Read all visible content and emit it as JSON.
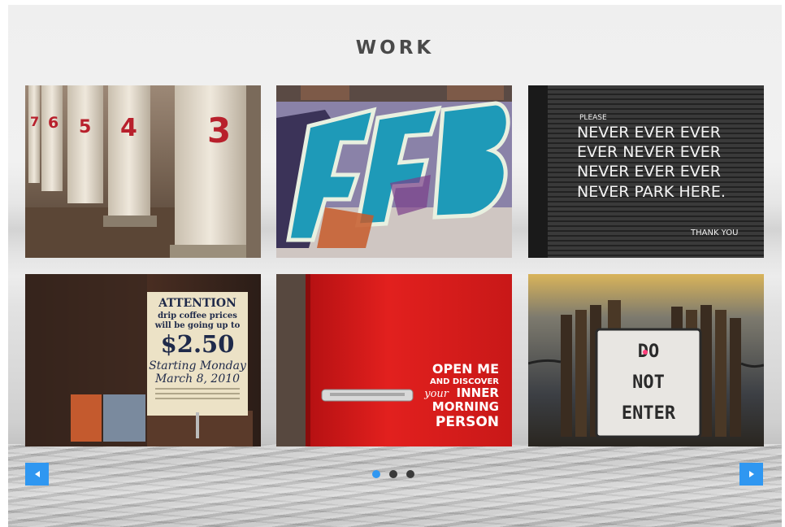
{
  "section": {
    "title": "WORK"
  },
  "gallery": {
    "tiles": [
      {
        "subject": "numbered white wooden pillars",
        "numbers": [
          "7",
          "6",
          "5",
          "4",
          "3"
        ]
      },
      {
        "subject": "blue graffiti lettering on brick wall"
      },
      {
        "subject": "no parking sign on rolling shutter",
        "lines": [
          "PLEASE",
          "NEVER EVER EVER",
          "EVER NEVER EVER",
          "NEVER EVER EVER",
          "NEVER PARK HERE.",
          "THANK YOU"
        ]
      },
      {
        "subject": "coffee price notice",
        "lines": [
          "ATTENTION",
          "drip coffee prices",
          "will be going up to",
          "$2.50",
          "Starting Monday",
          "March 8, 2010"
        ]
      },
      {
        "subject": "red refrigerator door",
        "lines": [
          "OPEN ME",
          "AND DISCOVER",
          "your",
          "INNER",
          "MORNING",
          "PERSON"
        ]
      },
      {
        "subject": "do not enter sign at sunset",
        "lines": [
          "DO",
          "NOT",
          "ENTER"
        ]
      }
    ]
  },
  "carousel": {
    "pages": 3,
    "active_page": 1,
    "prev_icon": "arrow-left-icon",
    "next_icon": "arrow-right-icon",
    "accent_color": "#2f97f1"
  }
}
